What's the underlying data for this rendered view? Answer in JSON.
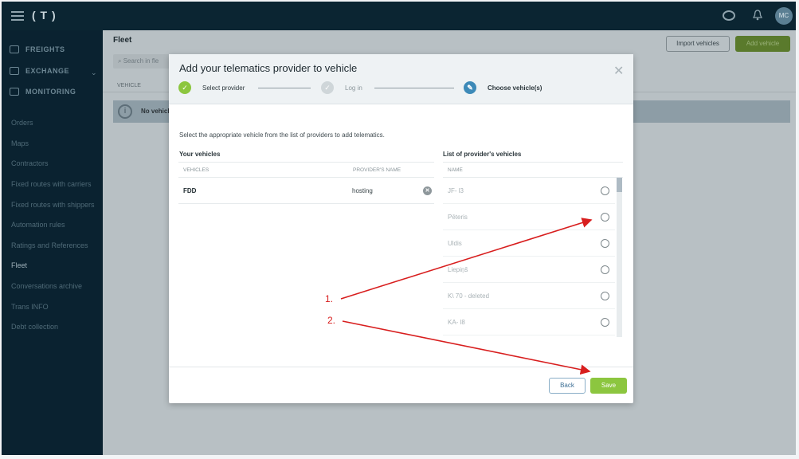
{
  "header": {
    "logo": "( T )",
    "avatar_initials": "MC"
  },
  "sidebar": {
    "main_items": [
      {
        "label": "FREIGHTS",
        "icon": "truck-icon"
      },
      {
        "label": "EXCHANGE",
        "icon": "box-icon"
      },
      {
        "label": "MONITORING",
        "icon": "route-icon"
      }
    ],
    "links": [
      "Orders",
      "Maps",
      "Contractors",
      "Fixed routes with carriers",
      "Fixed routes with shippers",
      "Automation rules",
      "Ratings and References",
      "Fleet",
      "Conversations archive",
      "Trans INFO",
      "Debt collection"
    ],
    "active_link": "Fleet"
  },
  "page": {
    "title": "Fleet",
    "import_button": "Import vehicles",
    "add_button": "Add vehicle",
    "search_placeholder": "Search in fle",
    "column_header": "VEHICLE",
    "info_text": "No vehicle"
  },
  "modal": {
    "title": "Add your telematics provider to vehicle",
    "close_icon": "close-icon",
    "steps": [
      {
        "label": "Select provider",
        "state": "done",
        "symbol": "✓"
      },
      {
        "label": "Log in",
        "state": "pending",
        "symbol": "✓"
      },
      {
        "label": "Choose vehicle(s)",
        "state": "current",
        "symbol": "✎"
      }
    ],
    "description": "Select the appropriate vehicle from the list of providers to add telematics.",
    "your_vehicles": {
      "title": "Your vehicles",
      "col_vehicles": "VEHICLES",
      "col_provider": "PROVIDER'S NAME",
      "rows": [
        {
          "vehicle": "FDD",
          "provider": "hosting",
          "remove_symbol": "✕"
        }
      ]
    },
    "provider_vehicles": {
      "title": "List of provider's vehicles",
      "col_name": "NAME",
      "rows": [
        "JF-    l3",
        "Pēteris",
        "Uldis",
        "Liepiņš",
        "K\\    70 - deleted",
        "KA-    l8"
      ]
    },
    "back_button": "Back",
    "save_button": "Save"
  },
  "annotations": {
    "labels": [
      "1.",
      "2."
    ],
    "color": "#d81e1e"
  },
  "colors": {
    "accent_green": "#8cc63f",
    "step_current": "#3d8ab8",
    "sidebar_bg": "#0a2230"
  }
}
